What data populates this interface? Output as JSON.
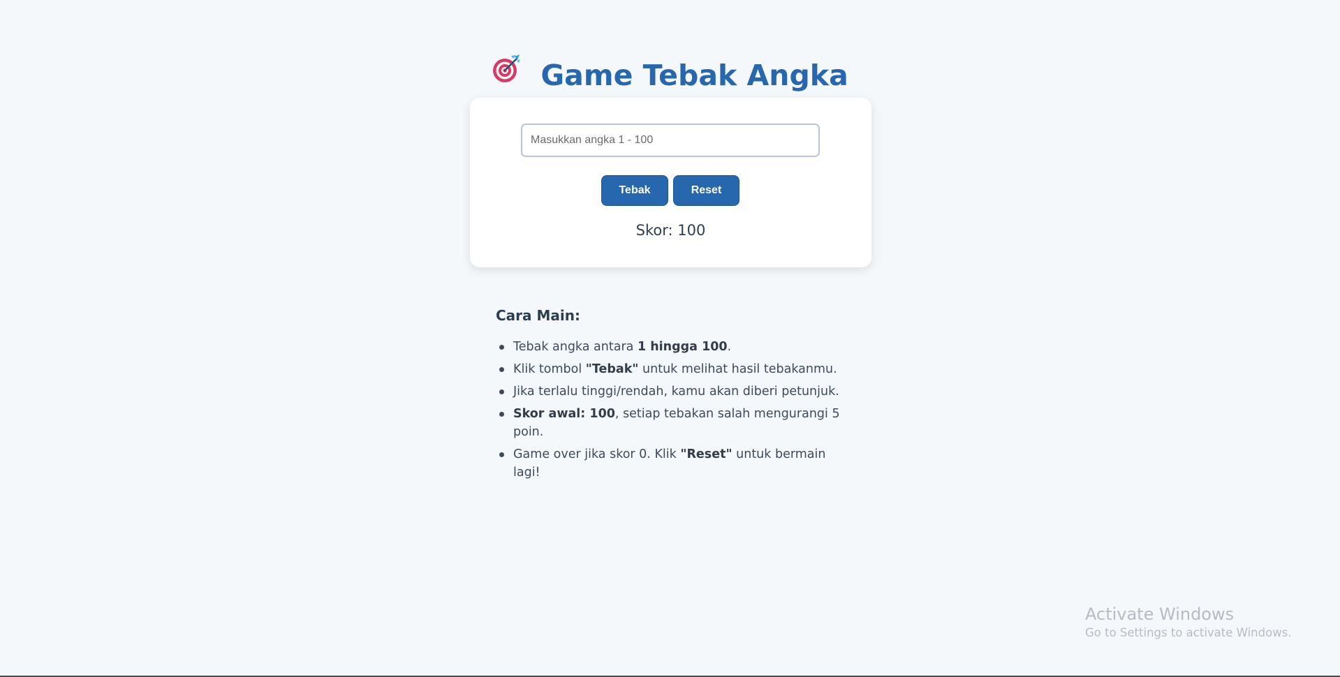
{
  "header": {
    "title": "Game Tebak Angka",
    "icon": "target-dart-icon"
  },
  "game": {
    "input_placeholder": "Masukkan angka 1 - 100",
    "input_value": "",
    "guess_button": "Tebak",
    "reset_button": "Reset",
    "score_text": "Skor: 100"
  },
  "rules": {
    "heading": "Cara Main:",
    "items": [
      {
        "pre": "Tebak angka antara ",
        "bold": "1 hingga 100",
        "post": "."
      },
      {
        "pre": "Klik tombol ",
        "bold": "\"Tebak\"",
        "post": " untuk melihat hasil tebakanmu."
      },
      {
        "pre": "Jika terlalu tinggi/rendah, kamu akan diberi petunjuk.",
        "bold": "",
        "post": ""
      },
      {
        "pre": "",
        "bold": "Skor awal: 100",
        "post": ", setiap tebakan salah mengurangi 5 poin."
      },
      {
        "pre": "Game over jika skor 0. Klik ",
        "bold": "\"Reset\"",
        "post": " untuk bermain lagi!"
      }
    ]
  },
  "watermark": {
    "title": "Activate Windows",
    "subtitle": "Go to Settings to activate Windows."
  },
  "colors": {
    "accent": "#2767ad",
    "background": "#f4f8fb",
    "card": "#ffffff"
  }
}
